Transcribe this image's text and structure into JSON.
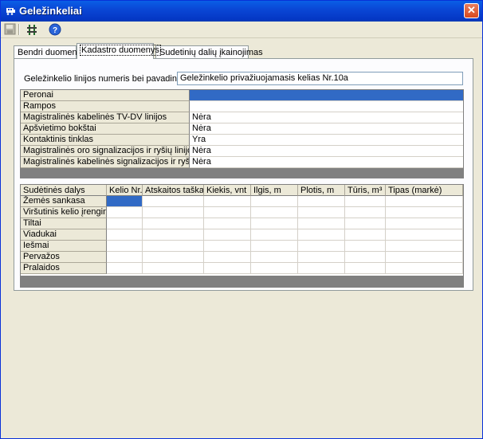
{
  "window": {
    "title": "Geležinkeliai",
    "close_label": "✕"
  },
  "toolbar": {
    "items": [
      "save-icon",
      "railway-track-icon",
      "help-icon"
    ]
  },
  "tabs": [
    {
      "label": "Bendri duomenys",
      "active": false
    },
    {
      "label": "Kadastro duomenys",
      "active": true
    },
    {
      "label": "Sudetinių dalių įkainojimas",
      "active": false
    }
  ],
  "line": {
    "label": "Geležinkelio linijos numeris bei pavadinimas",
    "value": "Geležinkelio privažiuojamasis kelias Nr.10a"
  },
  "props": {
    "rows": [
      {
        "label": "Peronai",
        "value": "",
        "selected": true
      },
      {
        "label": "Rampos",
        "value": ""
      },
      {
        "label": "Magistralinės kabelinės TV-DV linijos",
        "value": "Nėra"
      },
      {
        "label": "Apšvietimo bokštai",
        "value": "Nėra"
      },
      {
        "label": "Kontaktinis tinklas",
        "value": "Yra"
      },
      {
        "label": "Magistralinės oro signalizacijos ir ryšių linijos",
        "value": "Nėra"
      },
      {
        "label": "Magistralinės kabelinės signalizacijos ir ryšių linijos",
        "value": "Nėra"
      }
    ]
  },
  "parts": {
    "corner": "Sudėtinės dalys",
    "columns": [
      "Kelio Nr.",
      "Atskaitos taškai",
      "Kiekis, vnt",
      "Ilgis, m",
      "Plotis, m",
      "Tūris, m³",
      "Tipas (markė)"
    ],
    "rows": [
      "Žemės sankasa",
      "Viršutinis kelio įrenginys",
      "Tiltai",
      "Viadukai",
      "Iešmai",
      "Pervažos",
      "Pralaidos"
    ]
  },
  "colors": {
    "selection": "#316ac5",
    "title_bar": "#0a47d6"
  }
}
